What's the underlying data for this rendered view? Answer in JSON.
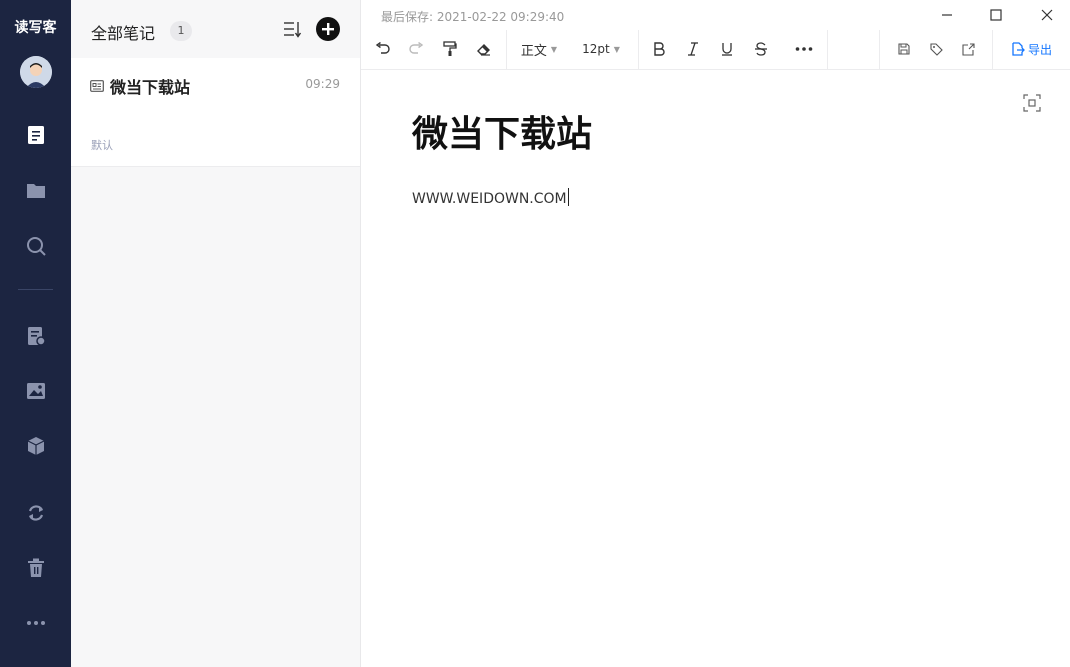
{
  "app": {
    "logo": "读写客"
  },
  "rail": {
    "items": [
      {
        "icon": "note-icon"
      },
      {
        "icon": "folder-icon"
      },
      {
        "icon": "search-icon"
      },
      {
        "icon": "note-comment-icon"
      },
      {
        "icon": "image-icon"
      },
      {
        "icon": "cube-icon"
      },
      {
        "icon": "sync-icon"
      },
      {
        "icon": "trash-icon"
      },
      {
        "icon": "more-icon"
      }
    ]
  },
  "list": {
    "title": "全部笔记",
    "count": "1",
    "notes": [
      {
        "title": "微当下载站",
        "time": "09:29",
        "folder": "默认"
      }
    ]
  },
  "editor": {
    "save_status": "最后保存: 2021-02-22 09:29:40",
    "toolbar": {
      "style_label": "正文",
      "size_label": "12pt",
      "export_label": "导出"
    },
    "heading": "微当下载站",
    "body": "WWW.WEIDOWN.COM"
  },
  "colors": {
    "rail_bg": "#1c2541",
    "accent": "#1677ff"
  }
}
